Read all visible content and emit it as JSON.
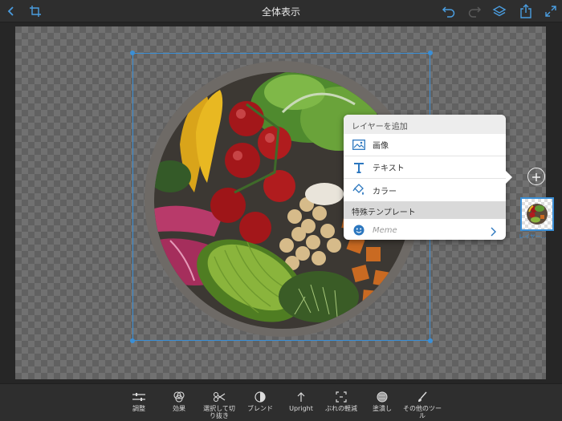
{
  "topbar": {
    "title": "全体表示",
    "icons": [
      "chevron-left-icon",
      "crop-icon",
      "undo-icon",
      "redo-icon",
      "layers-icon",
      "share-icon",
      "fullscreen-icon"
    ]
  },
  "canvas": {
    "layer_description": "salad-bowl image layer"
  },
  "popover": {
    "header": "レイヤーを追加",
    "items": [
      {
        "label": "画像",
        "icon": "image-icon"
      },
      {
        "label": "テキスト",
        "icon": "text-icon"
      },
      {
        "label": "カラー",
        "icon": "paint-bucket-icon"
      }
    ],
    "section": "特殊テンプレート",
    "template_items": [
      {
        "label": "Meme",
        "icon": "smiley-icon"
      }
    ]
  },
  "layers_panel": {
    "add_icon": "plus-icon",
    "thumbnail_label": "レイヤー..."
  },
  "toolbar": {
    "tools": [
      {
        "label": "調整",
        "icon": "sliders-icon"
      },
      {
        "label": "効果",
        "icon": "effects-icon"
      },
      {
        "label": "選択して切り抜き",
        "icon": "scissors-icon"
      },
      {
        "label": "ブレンド",
        "icon": "blend-icon"
      },
      {
        "label": "Upright",
        "icon": "upright-icon"
      },
      {
        "label": "ぶれの軽減",
        "icon": "shake-reduction-icon"
      },
      {
        "label": "塗潰し",
        "icon": "fill-icon"
      },
      {
        "label": "その他のツール",
        "icon": "brush-icon"
      }
    ]
  },
  "colors": {
    "accent": "#3b8fd6",
    "toolbar_bg": "#2e2e2e",
    "canvas_bg": "#262626"
  }
}
